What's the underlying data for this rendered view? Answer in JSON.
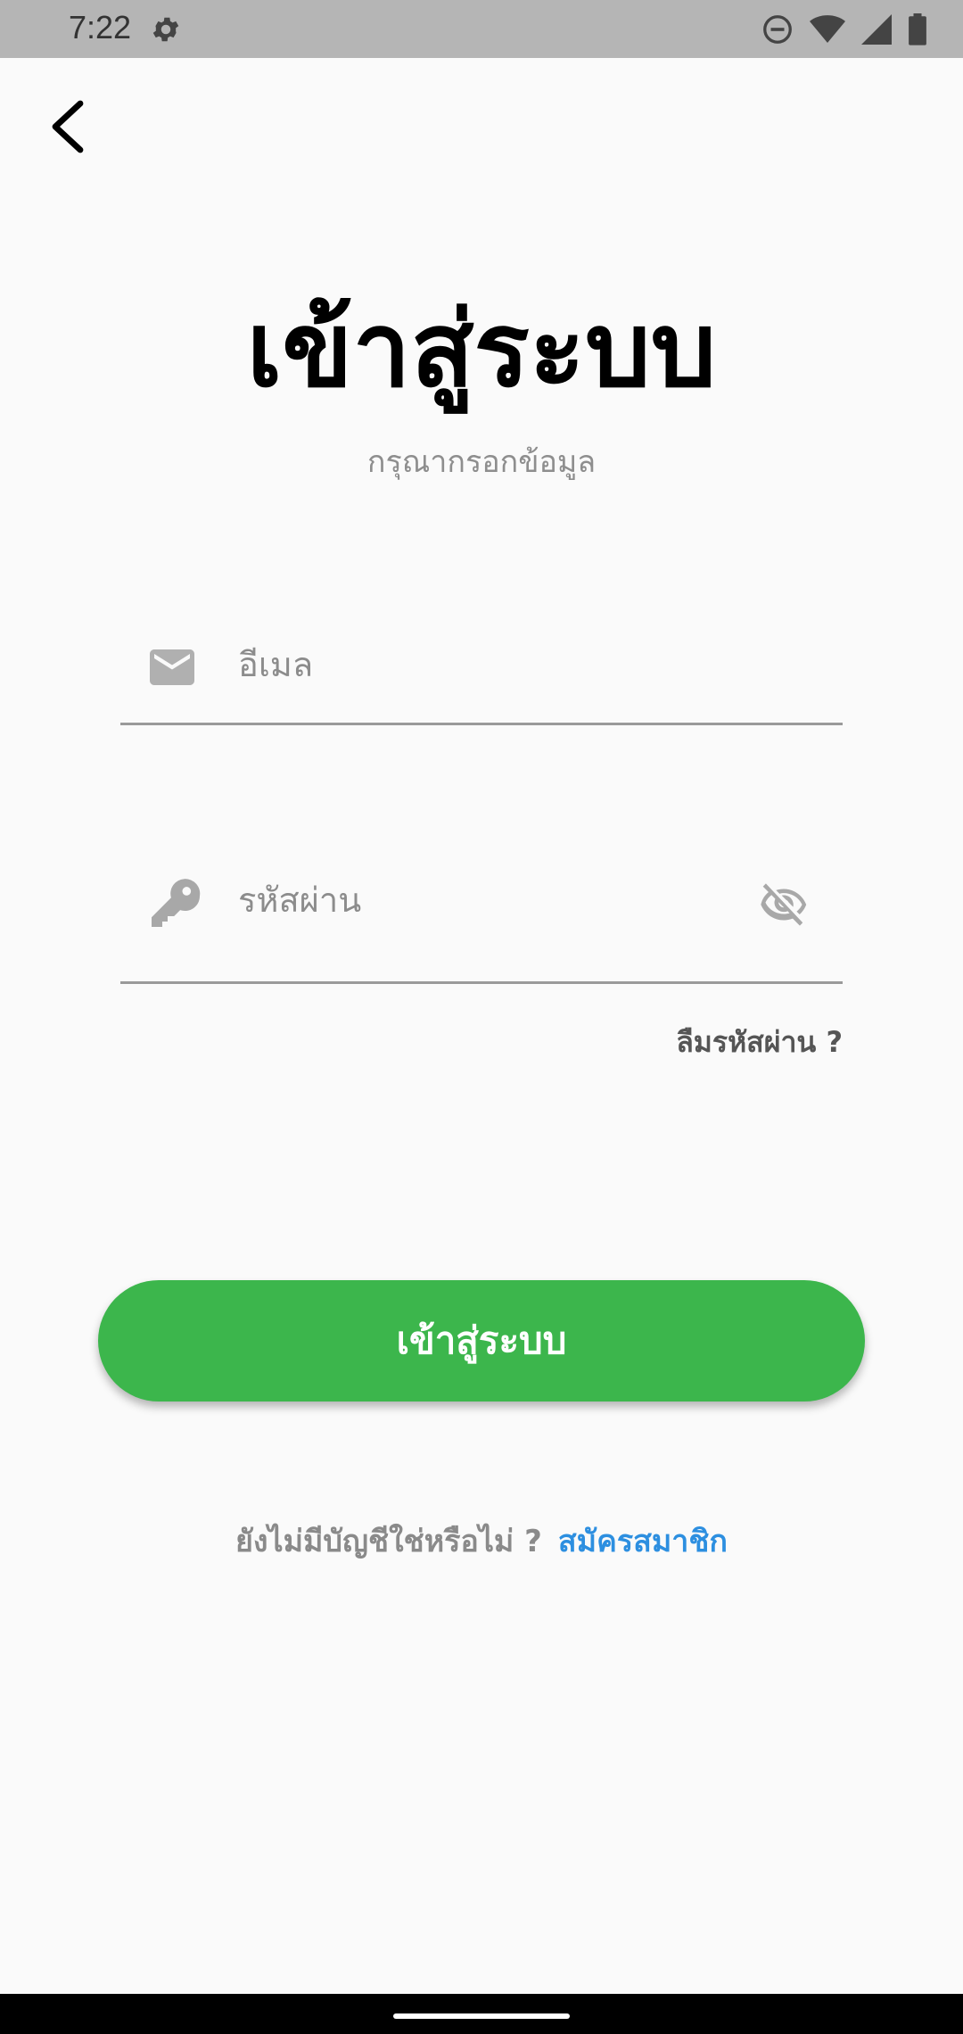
{
  "status": {
    "time": "7:22",
    "icons": [
      "settings-gear-icon",
      "do-not-disturb-icon",
      "wifi-icon",
      "cell-signal-icon",
      "battery-icon"
    ]
  },
  "header": {
    "back_icon": "arrow-back-icon"
  },
  "main": {
    "title": "เข้าสู่ระบบ",
    "subtitle": "กรุณากรอกข้อมูล",
    "email": {
      "icon": "mail-icon",
      "placeholder": "อีเมล",
      "value": ""
    },
    "password": {
      "icon": "key-icon",
      "placeholder": "รหัสผ่าน",
      "value": "",
      "toggle_icon": "visibility-off-icon"
    },
    "forgot_label": "ลืมรหัสผ่าน ?",
    "login_label": "เข้าสู่ระบบ",
    "signup_question": "ยังไม่มีบัญชีใช่หรือไม่ ?",
    "signup_link": "สมัครสมาชิก"
  },
  "colors": {
    "primary_button": "#3cb64c",
    "link": "#2d8fe0",
    "background": "#fafafa",
    "status_bar": "#b5b5b5"
  }
}
